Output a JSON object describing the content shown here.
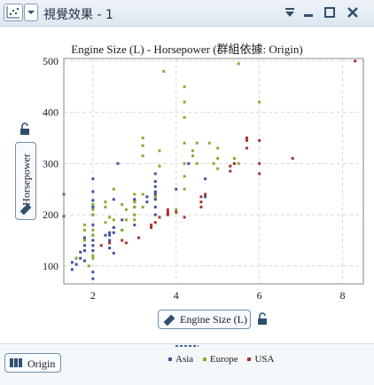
{
  "window": {
    "title": "視覺效果 - 1"
  },
  "chart_data": {
    "type": "scatter",
    "title": "Engine Size (L) - Horsepower (群組依據: Origin)",
    "xlabel": "Engine Size (L)",
    "ylabel": "Horsepower",
    "xlim": [
      1.3,
      8.5
    ],
    "ylim": [
      65,
      505
    ],
    "xticks": [
      2,
      4,
      6,
      8
    ],
    "yticks": [
      100,
      200,
      300,
      400,
      500
    ],
    "grid": true,
    "legend_position": "bottom",
    "group_by": "Origin",
    "series": [
      {
        "name": "Asia",
        "color": "#3b53a4",
        "points": [
          [
            1.3,
            240
          ],
          [
            1.3,
            197
          ],
          [
            1.5,
            93
          ],
          [
            1.5,
            107
          ],
          [
            1.6,
            103
          ],
          [
            1.6,
            115
          ],
          [
            1.7,
            115
          ],
          [
            1.7,
            127
          ],
          [
            1.8,
            110
          ],
          [
            1.8,
            130
          ],
          [
            1.8,
            140
          ],
          [
            1.8,
            155
          ],
          [
            2.0,
            130
          ],
          [
            2.0,
            140
          ],
          [
            2.0,
            150
          ],
          [
            2.0,
            160
          ],
          [
            2.0,
            180
          ],
          [
            2.0,
            200
          ],
          [
            2.0,
            215
          ],
          [
            2.0,
            228
          ],
          [
            2.0,
            245
          ],
          [
            2.0,
            270
          ],
          [
            2.0,
            75
          ],
          [
            2.0,
            88
          ],
          [
            2.3,
            160
          ],
          [
            2.4,
            135
          ],
          [
            2.4,
            150
          ],
          [
            2.4,
            160
          ],
          [
            2.4,
            165
          ],
          [
            2.5,
            125
          ],
          [
            2.5,
            165
          ],
          [
            2.5,
            175
          ],
          [
            2.5,
            230
          ],
          [
            2.6,
            300
          ],
          [
            2.7,
            170
          ],
          [
            2.7,
            190
          ],
          [
            3.0,
            180
          ],
          [
            3.0,
            200
          ],
          [
            3.0,
            215
          ],
          [
            3.0,
            225
          ],
          [
            3.0,
            230
          ],
          [
            3.3,
            225
          ],
          [
            3.3,
            235
          ],
          [
            3.5,
            200
          ],
          [
            3.5,
            215
          ],
          [
            3.5,
            230
          ],
          [
            3.5,
            240
          ],
          [
            3.5,
            245
          ],
          [
            3.5,
            255
          ],
          [
            3.5,
            265
          ],
          [
            3.5,
            280
          ],
          [
            3.8,
            200
          ],
          [
            4.0,
            250
          ],
          [
            4.3,
            300
          ],
          [
            4.7,
            235
          ],
          [
            4.7,
            270
          ]
        ]
      },
      {
        "name": "Europe",
        "color": "#8ca832",
        "points": [
          [
            1.6,
            115
          ],
          [
            1.8,
            150
          ],
          [
            1.8,
            180
          ],
          [
            1.8,
            170
          ],
          [
            1.9,
            100
          ],
          [
            2.0,
            115
          ],
          [
            2.0,
            120
          ],
          [
            2.0,
            160
          ],
          [
            2.0,
            170
          ],
          [
            2.0,
            200
          ],
          [
            2.0,
            210
          ],
          [
            2.0,
            220
          ],
          [
            2.3,
            185
          ],
          [
            2.3,
            215
          ],
          [
            2.3,
            225
          ],
          [
            2.4,
            195
          ],
          [
            2.5,
            190
          ],
          [
            2.5,
            250
          ],
          [
            2.7,
            170
          ],
          [
            2.7,
            220
          ],
          [
            2.8,
            190
          ],
          [
            2.8,
            210
          ],
          [
            3.0,
            190
          ],
          [
            3.0,
            200
          ],
          [
            3.0,
            215
          ],
          [
            3.0,
            225
          ],
          [
            3.0,
            240
          ],
          [
            3.2,
            215
          ],
          [
            3.2,
            240
          ],
          [
            3.2,
            335
          ],
          [
            3.2,
            350
          ],
          [
            3.2,
            315
          ],
          [
            3.5,
            235
          ],
          [
            3.6,
            295
          ],
          [
            3.6,
            325
          ],
          [
            3.7,
            480
          ],
          [
            4.0,
            210
          ],
          [
            4.2,
            250
          ],
          [
            4.2,
            275
          ],
          [
            4.2,
            300
          ],
          [
            4.2,
            340
          ],
          [
            4.2,
            390
          ],
          [
            4.2,
            420
          ],
          [
            4.2,
            450
          ],
          [
            4.4,
            315
          ],
          [
            4.4,
            325
          ],
          [
            4.5,
            300
          ],
          [
            4.5,
            340
          ],
          [
            4.8,
            340
          ],
          [
            4.9,
            300
          ],
          [
            5.0,
            290
          ],
          [
            5.0,
            310
          ],
          [
            5.0,
            330
          ],
          [
            5.4,
            310
          ],
          [
            5.5,
            300
          ],
          [
            5.5,
            495
          ],
          [
            6.0,
            420
          ]
        ]
      },
      {
        "name": "USA",
        "color": "#a83232",
        "points": [
          [
            2.2,
            140
          ],
          [
            2.4,
            145
          ],
          [
            2.7,
            150
          ],
          [
            2.8,
            145
          ],
          [
            3.1,
            155
          ],
          [
            3.4,
            175
          ],
          [
            3.4,
            180
          ],
          [
            3.5,
            185
          ],
          [
            3.6,
            195
          ],
          [
            3.8,
            200
          ],
          [
            3.8,
            205
          ],
          [
            3.8,
            210
          ],
          [
            4.0,
            205
          ],
          [
            4.2,
            195
          ],
          [
            4.6,
            215
          ],
          [
            4.6,
            225
          ],
          [
            4.6,
            235
          ],
          [
            4.7,
            240
          ],
          [
            5.3,
            285
          ],
          [
            5.3,
            295
          ],
          [
            5.4,
            300
          ],
          [
            5.7,
            330
          ],
          [
            5.7,
            345
          ],
          [
            5.7,
            350
          ],
          [
            6.0,
            280
          ],
          [
            6.0,
            300
          ],
          [
            6.0,
            345
          ],
          [
            6.8,
            310
          ],
          [
            8.3,
            500
          ]
        ]
      }
    ]
  },
  "colors": {
    "asia": "#3b53a4",
    "europe": "#8ca832",
    "usa": "#a83232",
    "grid": "#d9d9d9",
    "frame": "#8a8a8a"
  },
  "icons": {
    "chart_type": "scatter-plot-icon",
    "dropdown": "chevron-down-icon",
    "menu": "collapse-menu-icon",
    "minimize": "minimize-icon",
    "maximize": "maximize-icon",
    "close": "close-icon",
    "ruler": "ruler-icon",
    "lock": "lock-icon",
    "origin": "category-icon"
  },
  "origin_button": {
    "label": "Origin"
  }
}
